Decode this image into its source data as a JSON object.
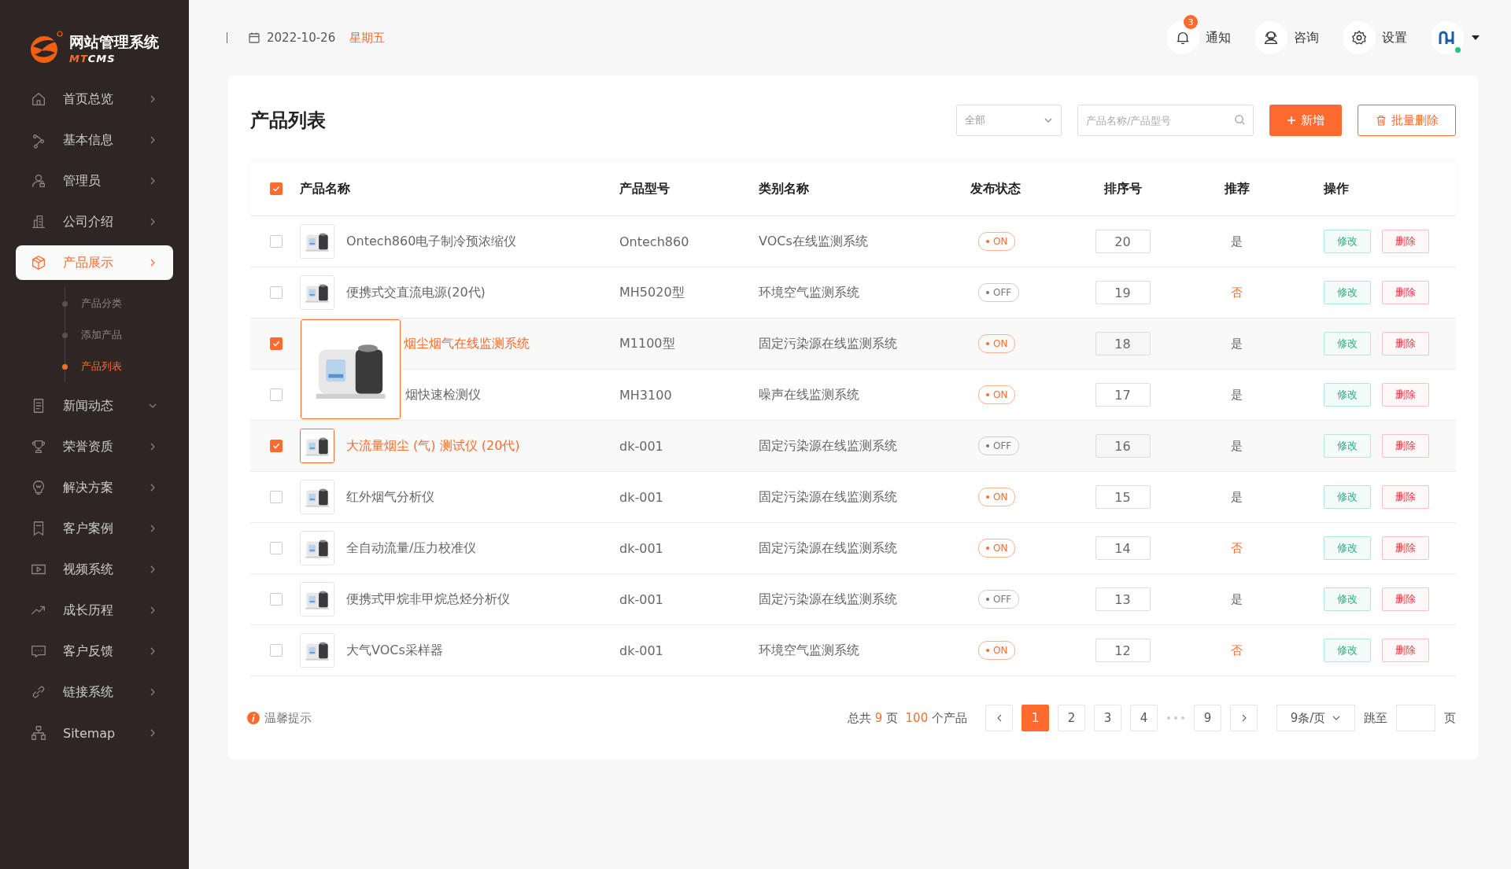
{
  "brand": {
    "title": "网站管理系统",
    "sub_a": "MT",
    "sub_b": "CMS"
  },
  "sidebar": {
    "items": [
      {
        "label": "首页总览",
        "selected": false,
        "caret_down": false
      },
      {
        "label": "基本信息",
        "selected": false,
        "caret_down": false
      },
      {
        "label": "管理员",
        "selected": false,
        "caret_down": false
      },
      {
        "label": "公司介绍",
        "selected": false,
        "caret_down": false
      },
      {
        "label": "产品展示",
        "selected": true,
        "caret_down": false,
        "children": [
          {
            "label": "产品分类",
            "selected": false
          },
          {
            "label": "添加产品",
            "selected": false
          },
          {
            "label": "产品列表",
            "selected": true
          }
        ]
      },
      {
        "label": "新闻动态",
        "selected": false,
        "caret_down": true
      },
      {
        "label": "荣誉资质",
        "selected": false,
        "caret_down": false
      },
      {
        "label": "解决方案",
        "selected": false,
        "caret_down": false
      },
      {
        "label": "客户案例",
        "selected": false,
        "caret_down": false
      },
      {
        "label": "视频系统",
        "selected": false,
        "caret_down": false
      },
      {
        "label": "成长历程",
        "selected": false,
        "caret_down": false
      },
      {
        "label": "客户反馈",
        "selected": false,
        "caret_down": false
      },
      {
        "label": "链接系统",
        "selected": false,
        "caret_down": false
      },
      {
        "label": "Sitemap",
        "selected": false,
        "caret_down": false
      }
    ]
  },
  "header": {
    "date": "2022-10-26",
    "weekday": "星期五",
    "actions": [
      {
        "label": "通知",
        "badge": "3"
      },
      {
        "label": "咨询"
      },
      {
        "label": "设置"
      }
    ],
    "user_online": true
  },
  "page": {
    "title": "产品列表",
    "filter": {
      "value": "全部"
    },
    "search": {
      "placeholder": "产品名称/产品型号"
    },
    "add_button": "新增",
    "batch_delete_button": "批量删除"
  },
  "table": {
    "all_checked": true,
    "columns": [
      "产品名称",
      "产品型号",
      "类别名称",
      "发布状态",
      "排序号",
      "推荐",
      "操作"
    ],
    "rows": [
      {
        "checked": false,
        "preview": false,
        "name": "Ontech860电子制冷预浓缩仪",
        "model": "Ontech860",
        "category": "VOCs在线监测系统",
        "on": true,
        "status": "ON",
        "sort": "20",
        "recommended": true,
        "recommend": "是",
        "edit": "修改",
        "delete": "删除"
      },
      {
        "checked": false,
        "preview": false,
        "name": "便携式交直流电源(20代)",
        "model": "MH5020型",
        "category": "环境空气监测系统",
        "on": false,
        "status": "OFF",
        "sort": "19",
        "recommended": false,
        "recommend": "否",
        "edit": "修改",
        "delete": "删除"
      },
      {
        "checked": true,
        "preview": true,
        "name": "烟尘烟气在线监测系统",
        "model": "M1100型",
        "category": "固定污染源在线监测系统",
        "on": true,
        "status": "ON",
        "sort": "18",
        "recommended": true,
        "recommend": "是",
        "edit": "修改",
        "delete": "删除"
      },
      {
        "checked": false,
        "name": "烟快速检测仪",
        "model": "MH3100",
        "category": "噪声在线监测系统",
        "on": true,
        "status": "ON",
        "sort": "17",
        "recommended": true,
        "recommend": "是",
        "edit": "修改",
        "delete": "删除"
      },
      {
        "checked": true,
        "preview": false,
        "name": "大流量烟尘 (气) 测试仪 (20代)",
        "model": "dk-001",
        "category": "固定污染源在线监测系统",
        "on": false,
        "status": "OFF",
        "sort": "16",
        "recommended": true,
        "recommend": "是",
        "edit": "修改",
        "delete": "删除"
      },
      {
        "checked": false,
        "preview": false,
        "name": "红外烟气分析仪",
        "model": "dk-001",
        "category": "固定污染源在线监测系统",
        "on": true,
        "status": "ON",
        "sort": "15",
        "recommended": true,
        "recommend": "是",
        "edit": "修改",
        "delete": "删除"
      },
      {
        "checked": false,
        "preview": false,
        "name": "全自动流量/压力校准仪",
        "model": "dk-001",
        "category": "固定污染源在线监测系统",
        "on": true,
        "status": "ON",
        "sort": "14",
        "recommended": false,
        "recommend": "否",
        "edit": "修改",
        "delete": "删除"
      },
      {
        "checked": false,
        "preview": false,
        "name": "便携式甲烷非甲烷总烃分析仪",
        "model": "dk-001",
        "category": "固定污染源在线监测系统",
        "on": false,
        "status": "OFF",
        "sort": "13",
        "recommended": true,
        "recommend": "是",
        "edit": "修改",
        "delete": "删除"
      },
      {
        "checked": false,
        "preview": false,
        "name": "大气VOCs采样器",
        "model": "dk-001",
        "category": "环境空气监测系统",
        "on": true,
        "status": "ON",
        "sort": "12",
        "recommended": false,
        "recommend": "否",
        "edit": "修改",
        "delete": "删除"
      }
    ]
  },
  "footer": {
    "tip": "温馨提示",
    "summary": {
      "prefix": "总共",
      "pages": "9",
      "pages_unit": "页",
      "count": "100",
      "count_unit": "个产品"
    },
    "pages": [
      {
        "label": "1",
        "selected": true
      },
      {
        "label": "2",
        "selected": false
      },
      {
        "label": "3",
        "selected": false
      },
      {
        "label": "4",
        "selected": false
      },
      {
        "kind": "ellipsis"
      },
      {
        "label": "9",
        "selected": false
      }
    ],
    "page_size": "9条/页",
    "jump_label": "跳至",
    "jump_unit": "页"
  }
}
